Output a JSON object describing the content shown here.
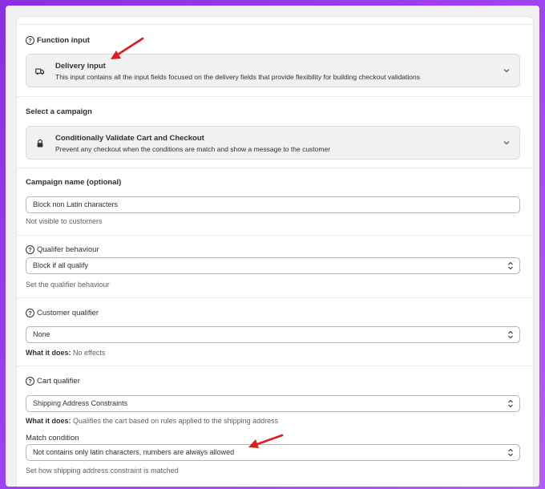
{
  "function_input": {
    "label": "Function input",
    "selected_title": "Delivery input",
    "selected_desc": "This input contains all the input fields focused on the delivery fields that provide flexibility for building checkout validations"
  },
  "campaign": {
    "label": "Select a campaign",
    "selected_title": "Conditionally Validate Cart and Checkout",
    "selected_desc": "Prevent any checkout when the conditions are match and show a message to the customer"
  },
  "campaign_name": {
    "label": "Campaign name (optional)",
    "value": "Block non Latin characters",
    "help": "Not visible to customers"
  },
  "qualifier_behaviour": {
    "label": "Qualifer behaviour",
    "value": "Block if all qualify",
    "help": "Set the qualifier behaviour"
  },
  "customer_qualifier": {
    "label": "Customer qualifier",
    "value": "None",
    "help_prefix": "What it does:",
    "help_text": "No effects"
  },
  "cart_qualifier": {
    "label": "Cart qualifier",
    "value": "Shipping Address Constraints",
    "help_prefix": "What it does:",
    "help_text": "Qualifies the cart based on rules applied to the shipping address"
  },
  "match_condition": {
    "label": "Match condition",
    "value": "Not contains only latin characters, numbers are always allowed",
    "help": "Set how shipping address constraint is matched"
  },
  "colors": {
    "background_gradient_start": "#8b2fe0",
    "annotation_arrow": "#e01b1b"
  },
  "icons": {
    "help": "question-circle-icon",
    "delivery": "truck-icon",
    "campaign": "lock-icon",
    "accordion": "chevron-down-icon",
    "select": "select-arrows-icon"
  }
}
